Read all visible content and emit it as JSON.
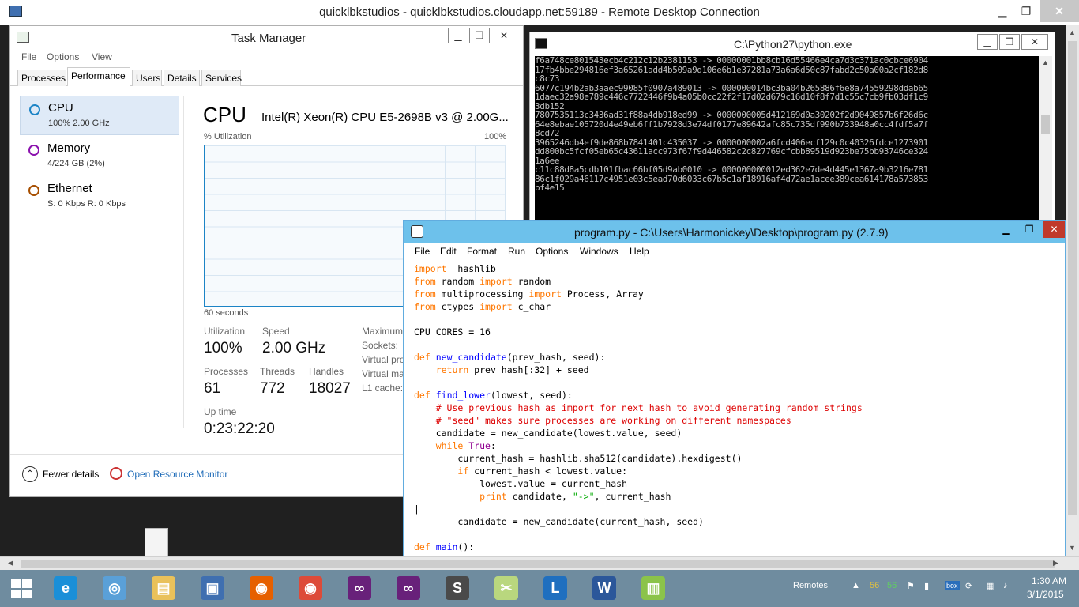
{
  "rdp": {
    "title": "quicklbkstudios - quicklbkstudios.cloudapp.net:59189 - Remote Desktop Connection",
    "min": "▁",
    "max": "❐",
    "close": "✕"
  },
  "task_manager": {
    "title": "Task Manager",
    "menu": [
      "File",
      "Options",
      "View"
    ],
    "tabs": [
      "Processes",
      "Performance",
      "Users",
      "Details",
      "Services"
    ],
    "active_tab": "Performance",
    "resources": [
      {
        "name": "CPU",
        "sub": "100%  2.00 GHz",
        "color": "#1c84c6"
      },
      {
        "name": "Memory",
        "sub": "4/224 GB (2%)",
        "color": "#8b12ae"
      },
      {
        "name": "Ethernet",
        "sub": "S: 0 Kbps  R: 0 Kbps",
        "color": "#a74f01"
      }
    ],
    "cpu_heading": "CPU",
    "cpu_model": "Intel(R) Xeon(R) CPU E5-2698B v3 @ 2.00G...",
    "util_label": "% Utilization",
    "util_max": "100%",
    "time_span": "60 seconds",
    "stats": {
      "utilization_label": "Utilization",
      "utilization": "100%",
      "speed_label": "Speed",
      "speed": "2.00 GHz",
      "processes_label": "Processes",
      "processes": "61",
      "threads_label": "Threads",
      "threads": "772",
      "handles_label": "Handles",
      "handles": "18027",
      "uptime_label": "Up time",
      "uptime": "0:23:22:20"
    },
    "right_labels": [
      "Maximum",
      "Sockets:",
      "Virtual pro",
      "Virtual ma",
      "L1 cache:"
    ],
    "fewer_details": "Fewer details",
    "open_monitor": "Open Resource Monitor"
  },
  "python": {
    "title": "C:\\Python27\\python.exe",
    "lines": [
      "f6a748ce801543ecb4c212c12b2381153 -> 00000001bb8cb16d55466e4ca7d3c371ac0cbce6904",
      "17fb4bbe294816ef3a65261add4b509a9d106e6b1e37281a73a6a6d50c87fabd2c50a00a2cf182d8",
      "c8c73",
      "6077c194b2ab3aaec99085f0907a489013 -> 000000014bc3ba04b265886f6e8a74559298ddab65",
      "1daec32a98e789c446c7722446f9b4a05b0cc22f2f17d02d679c16d10f8f7d1c55c7cb9fb03df1c9",
      "3db152",
      "7807535113c3436ad31f88a4db918ed99 -> 0000000005d412169d0a30202f2d9049857b6f26d6c",
      "64e8ebae105720d4e49eb6ff1b7928d3e74df0177e89642afc85c735df990b733948a0cc4fdf5a7f",
      "8cd72",
      "3965246db4ef9de868b7841401c435037 -> 0000000002a6fcd406ecf129c0c40326fdce1273901",
      "dd800bc5fcf05eb65c43611acc973f67f9d446582c2c827769cfcbb89519d923be75bb93746ce324",
      "1a6ee",
      "c11c88d8a5cdb101fbac66bf05d9ab0010 -> 000000000012ed362e7de4d445e1367a9b3216e781",
      "86c1f029a46117c4951e03c5ead70d6033c67b5c1af18916af4d72ae1acee389cea614178a573853",
      "bf4e15"
    ]
  },
  "idle": {
    "title": "program.py - C:\\Users\\Harmonickey\\Desktop\\program.py (2.7.9)",
    "menu": [
      "File",
      "Edit",
      "Format",
      "Run",
      "Options",
      "Windows",
      "Help"
    ],
    "code": [
      [
        [
          "kw",
          "import"
        ],
        [
          "",
          "  hashlib"
        ]
      ],
      [
        [
          "kw",
          "from"
        ],
        [
          "",
          " random "
        ],
        [
          "kw",
          "import"
        ],
        [
          "",
          " random"
        ]
      ],
      [
        [
          "kw",
          "from"
        ],
        [
          "",
          " multiprocessing "
        ],
        [
          "kw",
          "import"
        ],
        [
          "",
          " Process, Array"
        ]
      ],
      [
        [
          "kw",
          "from"
        ],
        [
          "",
          " ctypes "
        ],
        [
          "kw",
          "import"
        ],
        [
          "",
          " c_char"
        ]
      ],
      [],
      [
        [
          "",
          "CPU_CORES = 16"
        ]
      ],
      [],
      [
        [
          "kw",
          "def"
        ],
        [
          "",
          " "
        ],
        [
          "fn",
          "new_candidate"
        ],
        [
          "",
          "(prev_hash, seed):"
        ]
      ],
      [
        [
          "",
          "    "
        ],
        [
          "kw",
          "return"
        ],
        [
          "",
          " prev_hash[:32] + seed"
        ]
      ],
      [],
      [
        [
          "kw",
          "def"
        ],
        [
          "",
          " "
        ],
        [
          "fn",
          "find_lower"
        ],
        [
          "",
          "(lowest, seed):"
        ]
      ],
      [
        [
          "",
          "    "
        ],
        [
          "cm",
          "# Use previous hash as import for next hash to avoid generating random strings"
        ]
      ],
      [
        [
          "",
          "    "
        ],
        [
          "cm",
          "# \"seed\" makes sure processes are working on different namespaces"
        ]
      ],
      [
        [
          "",
          "    candidate = new_candidate(lowest.value, seed)"
        ]
      ],
      [
        [
          "",
          "    "
        ],
        [
          "kw",
          "while"
        ],
        [
          "",
          " "
        ],
        [
          "bi",
          "True"
        ],
        [
          "",
          ":"
        ]
      ],
      [
        [
          "",
          "        current_hash = hashlib.sha512(candidate).hexdigest()"
        ]
      ],
      [
        [
          "",
          "        "
        ],
        [
          "kw",
          "if"
        ],
        [
          "",
          " current_hash < lowest.value:"
        ]
      ],
      [
        [
          "",
          "            lowest.value = current_hash"
        ]
      ],
      [
        [
          "",
          "            "
        ],
        [
          "kw",
          "print"
        ],
        [
          "",
          " candidate, "
        ],
        [
          "st",
          "\"->\""
        ],
        [
          "",
          ", current_hash"
        ]
      ],
      [
        [
          "",
          "|"
        ]
      ],
      [
        [
          "",
          "        candidate = new_candidate(current_hash, seed)"
        ]
      ],
      [],
      [
        [
          "kw",
          "def"
        ],
        [
          "",
          " "
        ],
        [
          "fn",
          "main"
        ],
        [
          "",
          "():"
        ]
      ]
    ]
  },
  "taskbar": {
    "apps": [
      {
        "name": "ie-icon",
        "color": "#1a8fd8",
        "glyph": "e"
      },
      {
        "name": "safari-icon",
        "color": "#5aa0d8",
        "glyph": "◎"
      },
      {
        "name": "file-explorer-icon",
        "color": "#e9c15a",
        "glyph": "▤"
      },
      {
        "name": "remote-desktop-icon",
        "color": "#3f6fb0",
        "glyph": "▣"
      },
      {
        "name": "firefox-icon",
        "color": "#e66000",
        "glyph": "◉"
      },
      {
        "name": "chrome-icon",
        "color": "#dd4b39",
        "glyph": "◉"
      },
      {
        "name": "visual-studio-icon",
        "color": "#68217a",
        "glyph": "∞"
      },
      {
        "name": "visual-studio-2-icon",
        "color": "#68217a",
        "glyph": "∞"
      },
      {
        "name": "sublime-icon",
        "color": "#4a4a4a",
        "glyph": "S"
      },
      {
        "name": "snipping-icon",
        "color": "#b9d77e",
        "glyph": "✂"
      },
      {
        "name": "lync-icon",
        "color": "#1f6fbf",
        "glyph": "L"
      },
      {
        "name": "word-icon",
        "color": "#2b579a",
        "glyph": "W"
      },
      {
        "name": "task-manager-icon",
        "color": "#8bc34a",
        "glyph": "▥"
      }
    ],
    "remotes": "Remotes",
    "temp1": "56",
    "temp2": "56",
    "time": "1:30 AM",
    "date": "3/1/2015"
  }
}
